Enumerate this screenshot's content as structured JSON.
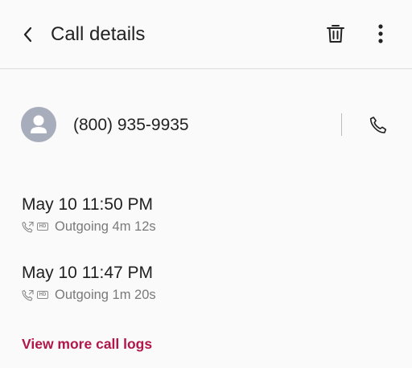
{
  "header": {
    "title": "Call details",
    "back_icon": "chevron-left-icon",
    "delete_icon": "trash-icon",
    "more_icon": "more-vert-icon"
  },
  "contact": {
    "number": "(800) 935-9935",
    "avatar_icon": "person-avatar-icon",
    "call_icon": "phone-icon"
  },
  "call_logs": [
    {
      "datetime": "May 10 11:50 PM",
      "detail": "Outgoing 4m 12s",
      "direction_icon": "outgoing-call-icon",
      "hd_badge": "HD"
    },
    {
      "datetime": "May 10 11:47 PM",
      "detail": "Outgoing 1m 20s",
      "direction_icon": "outgoing-call-icon",
      "hd_badge": "HD"
    }
  ],
  "view_more_label": "View more call logs",
  "colors": {
    "accent": "#b0174a",
    "avatar_bg": "#a7adba",
    "background": "#fafafa"
  }
}
